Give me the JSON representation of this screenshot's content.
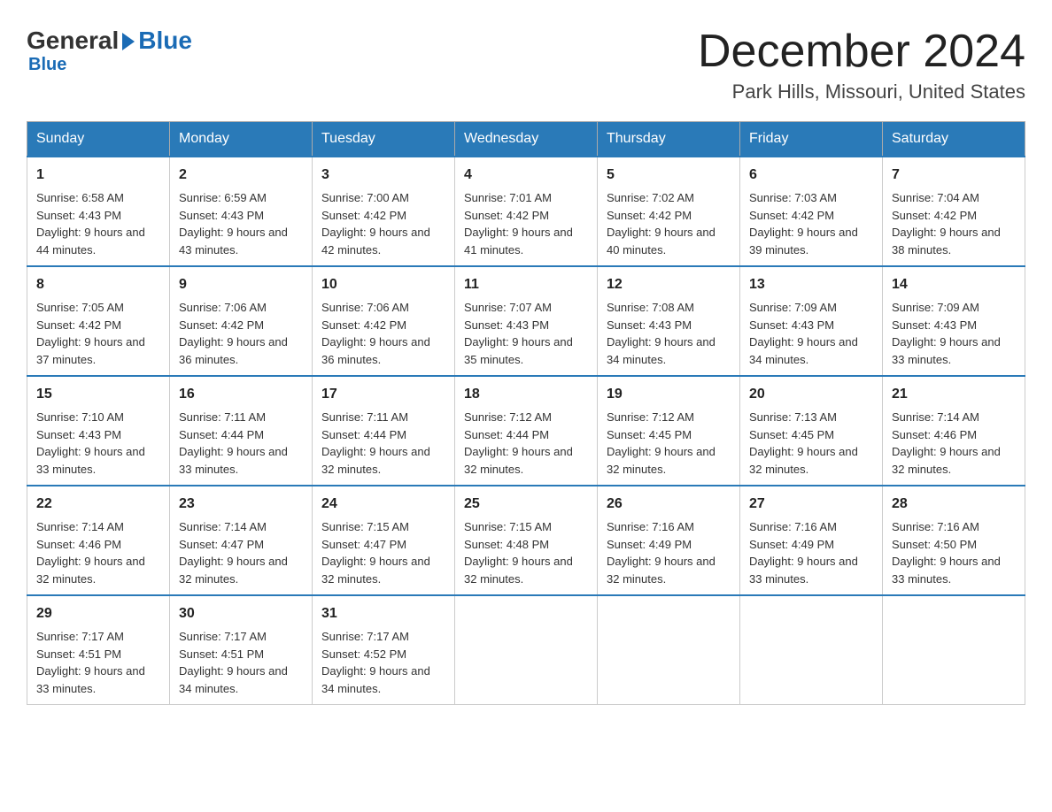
{
  "header": {
    "logo": {
      "general": "General",
      "blue": "Blue"
    },
    "title": "December 2024",
    "location": "Park Hills, Missouri, United States"
  },
  "days_of_week": [
    "Sunday",
    "Monday",
    "Tuesday",
    "Wednesday",
    "Thursday",
    "Friday",
    "Saturday"
  ],
  "weeks": [
    [
      {
        "day": "1",
        "sunrise": "6:58 AM",
        "sunset": "4:43 PM",
        "daylight": "9 hours and 44 minutes."
      },
      {
        "day": "2",
        "sunrise": "6:59 AM",
        "sunset": "4:43 PM",
        "daylight": "9 hours and 43 minutes."
      },
      {
        "day": "3",
        "sunrise": "7:00 AM",
        "sunset": "4:42 PM",
        "daylight": "9 hours and 42 minutes."
      },
      {
        "day": "4",
        "sunrise": "7:01 AM",
        "sunset": "4:42 PM",
        "daylight": "9 hours and 41 minutes."
      },
      {
        "day": "5",
        "sunrise": "7:02 AM",
        "sunset": "4:42 PM",
        "daylight": "9 hours and 40 minutes."
      },
      {
        "day": "6",
        "sunrise": "7:03 AM",
        "sunset": "4:42 PM",
        "daylight": "9 hours and 39 minutes."
      },
      {
        "day": "7",
        "sunrise": "7:04 AM",
        "sunset": "4:42 PM",
        "daylight": "9 hours and 38 minutes."
      }
    ],
    [
      {
        "day": "8",
        "sunrise": "7:05 AM",
        "sunset": "4:42 PM",
        "daylight": "9 hours and 37 minutes."
      },
      {
        "day": "9",
        "sunrise": "7:06 AM",
        "sunset": "4:42 PM",
        "daylight": "9 hours and 36 minutes."
      },
      {
        "day": "10",
        "sunrise": "7:06 AM",
        "sunset": "4:42 PM",
        "daylight": "9 hours and 36 minutes."
      },
      {
        "day": "11",
        "sunrise": "7:07 AM",
        "sunset": "4:43 PM",
        "daylight": "9 hours and 35 minutes."
      },
      {
        "day": "12",
        "sunrise": "7:08 AM",
        "sunset": "4:43 PM",
        "daylight": "9 hours and 34 minutes."
      },
      {
        "day": "13",
        "sunrise": "7:09 AM",
        "sunset": "4:43 PM",
        "daylight": "9 hours and 34 minutes."
      },
      {
        "day": "14",
        "sunrise": "7:09 AM",
        "sunset": "4:43 PM",
        "daylight": "9 hours and 33 minutes."
      }
    ],
    [
      {
        "day": "15",
        "sunrise": "7:10 AM",
        "sunset": "4:43 PM",
        "daylight": "9 hours and 33 minutes."
      },
      {
        "day": "16",
        "sunrise": "7:11 AM",
        "sunset": "4:44 PM",
        "daylight": "9 hours and 33 minutes."
      },
      {
        "day": "17",
        "sunrise": "7:11 AM",
        "sunset": "4:44 PM",
        "daylight": "9 hours and 32 minutes."
      },
      {
        "day": "18",
        "sunrise": "7:12 AM",
        "sunset": "4:44 PM",
        "daylight": "9 hours and 32 minutes."
      },
      {
        "day": "19",
        "sunrise": "7:12 AM",
        "sunset": "4:45 PM",
        "daylight": "9 hours and 32 minutes."
      },
      {
        "day": "20",
        "sunrise": "7:13 AM",
        "sunset": "4:45 PM",
        "daylight": "9 hours and 32 minutes."
      },
      {
        "day": "21",
        "sunrise": "7:14 AM",
        "sunset": "4:46 PM",
        "daylight": "9 hours and 32 minutes."
      }
    ],
    [
      {
        "day": "22",
        "sunrise": "7:14 AM",
        "sunset": "4:46 PM",
        "daylight": "9 hours and 32 minutes."
      },
      {
        "day": "23",
        "sunrise": "7:14 AM",
        "sunset": "4:47 PM",
        "daylight": "9 hours and 32 minutes."
      },
      {
        "day": "24",
        "sunrise": "7:15 AM",
        "sunset": "4:47 PM",
        "daylight": "9 hours and 32 minutes."
      },
      {
        "day": "25",
        "sunrise": "7:15 AM",
        "sunset": "4:48 PM",
        "daylight": "9 hours and 32 minutes."
      },
      {
        "day": "26",
        "sunrise": "7:16 AM",
        "sunset": "4:49 PM",
        "daylight": "9 hours and 32 minutes."
      },
      {
        "day": "27",
        "sunrise": "7:16 AM",
        "sunset": "4:49 PM",
        "daylight": "9 hours and 33 minutes."
      },
      {
        "day": "28",
        "sunrise": "7:16 AM",
        "sunset": "4:50 PM",
        "daylight": "9 hours and 33 minutes."
      }
    ],
    [
      {
        "day": "29",
        "sunrise": "7:17 AM",
        "sunset": "4:51 PM",
        "daylight": "9 hours and 33 minutes."
      },
      {
        "day": "30",
        "sunrise": "7:17 AM",
        "sunset": "4:51 PM",
        "daylight": "9 hours and 34 minutes."
      },
      {
        "day": "31",
        "sunrise": "7:17 AM",
        "sunset": "4:52 PM",
        "daylight": "9 hours and 34 minutes."
      },
      null,
      null,
      null,
      null
    ]
  ],
  "labels": {
    "sunrise": "Sunrise:",
    "sunset": "Sunset:",
    "daylight": "Daylight:"
  }
}
